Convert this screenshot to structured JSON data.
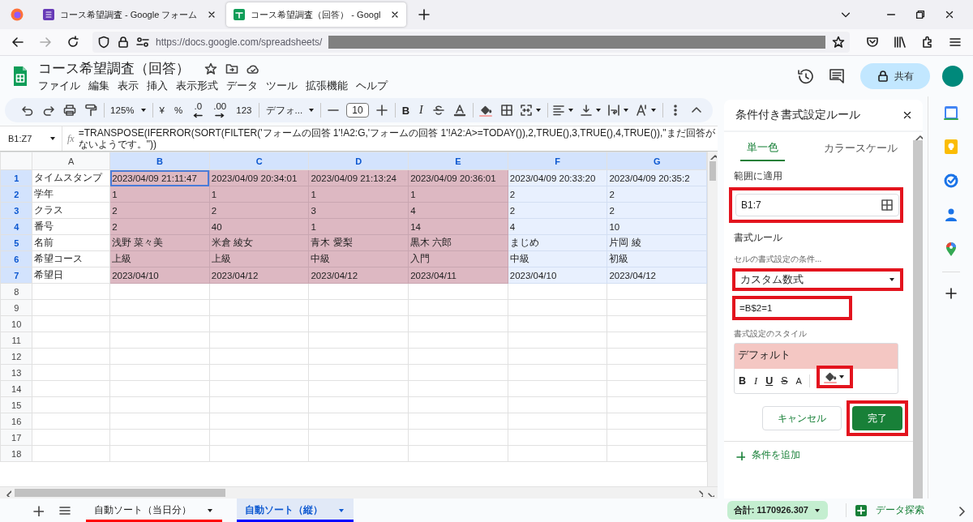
{
  "browser": {
    "tabs": [
      {
        "title": "コース希望調査 - Google フォーム",
        "selected": false,
        "kind": "forms"
      },
      {
        "title": "コース希望調査（回答） - Googl",
        "selected": true,
        "kind": "sheets"
      }
    ],
    "url": "https://docs.google.com/spreadsheets/"
  },
  "doc": {
    "title": "コース希望調査（回答）",
    "menu": [
      "ファイル",
      "編集",
      "表示",
      "挿入",
      "表示形式",
      "データ",
      "ツール",
      "拡張機能",
      "ヘルプ"
    ],
    "share": "共有"
  },
  "toolbar": [
    {
      "kind": "undo"
    },
    {
      "kind": "redo"
    },
    {
      "kind": "print"
    },
    {
      "kind": "paint"
    },
    {
      "kind": "sep"
    },
    {
      "kind": "dropdown",
      "text": "125%"
    },
    {
      "kind": "sep"
    },
    {
      "kind": "text",
      "text": "¥"
    },
    {
      "kind": "text",
      "text": "%"
    },
    {
      "kind": "decdown",
      "text": ".0"
    },
    {
      "kind": "decup",
      "text": ".00"
    },
    {
      "kind": "text",
      "text": "123"
    },
    {
      "kind": "sep"
    },
    {
      "kind": "dropdown",
      "text": "デフォ..."
    },
    {
      "kind": "sep"
    },
    {
      "kind": "minus"
    },
    {
      "kind": "size",
      "text": "10"
    },
    {
      "kind": "plus"
    },
    {
      "kind": "sep"
    },
    {
      "kind": "bold",
      "text": "B"
    },
    {
      "kind": "italic",
      "text": "I"
    },
    {
      "kind": "strike"
    },
    {
      "kind": "textcolor"
    },
    {
      "kind": "sep"
    },
    {
      "kind": "fill"
    },
    {
      "kind": "borders"
    },
    {
      "kind": "merge"
    },
    {
      "kind": "sep"
    },
    {
      "kind": "halign"
    },
    {
      "kind": "valign"
    },
    {
      "kind": "wrap"
    },
    {
      "kind": "rotate"
    },
    {
      "kind": "sep"
    },
    {
      "kind": "more"
    },
    {
      "kind": "collapse"
    }
  ],
  "formula_bar": {
    "cell_ref": "B1:Z7",
    "fx": "fx",
    "formula": "=TRANSPOSE(IFERROR(SORT(FILTER('フォームの回答 1'!A2:G,'フォームの回答 1'!A2:A>=TODAY()),2,TRUE(),3,TRUE(),4,TRUE()),\"まだ回答がないようです。\"))"
  },
  "grid": {
    "columns": [
      {
        "label": "A",
        "selected": false,
        "highlighted": false
      },
      {
        "label": "B",
        "selected": true,
        "highlighted": true
      },
      {
        "label": "C",
        "selected": true,
        "highlighted": true
      },
      {
        "label": "D",
        "selected": true,
        "highlighted": true
      },
      {
        "label": "E",
        "selected": true,
        "highlighted": true
      },
      {
        "label": "F",
        "selected": true,
        "highlighted": false
      },
      {
        "label": "G",
        "selected": true,
        "highlighted": false
      }
    ],
    "rows": [
      {
        "number": "1",
        "selected": true,
        "cells": [
          "タイムスタンプ",
          "2023/04/09 21:11:47",
          "2023/04/09 20:34:01",
          "2023/04/09 21:13:24",
          "2023/04/09 20:36:01",
          "2023/04/09 20:33:20",
          "2023/04/09 20:35:2"
        ]
      },
      {
        "number": "2",
        "selected": true,
        "cells": [
          "学年",
          "1",
          "1",
          "1",
          "1",
          "2",
          "2"
        ]
      },
      {
        "number": "3",
        "selected": true,
        "cells": [
          "クラス",
          "2",
          "2",
          "3",
          "4",
          "2",
          "2"
        ]
      },
      {
        "number": "4",
        "selected": true,
        "cells": [
          "番号",
          "2",
          "40",
          "1",
          "14",
          "4",
          "10"
        ]
      },
      {
        "number": "5",
        "selected": true,
        "cells": [
          "名前",
          "浅野 菜々美",
          "米倉 綾女",
          "青木 愛梨",
          "黒木 六郎",
          "まじめ",
          "片岡 綾"
        ]
      },
      {
        "number": "6",
        "selected": true,
        "cells": [
          "希望コース",
          "上級",
          "上級",
          "中級",
          "入門",
          "中級",
          "初級"
        ]
      },
      {
        "number": "7",
        "selected": true,
        "cells": [
          "希望日",
          "2023/04/10",
          "2023/04/12",
          "2023/04/12",
          "2023/04/11",
          "2023/04/10",
          "2023/04/12"
        ]
      },
      {
        "number": "8",
        "selected": false
      },
      {
        "number": "9",
        "selected": false
      },
      {
        "number": "10",
        "selected": false
      },
      {
        "number": "11",
        "selected": false
      },
      {
        "number": "12",
        "selected": false
      },
      {
        "number": "13",
        "selected": false
      },
      {
        "number": "14",
        "selected": false
      },
      {
        "number": "15",
        "selected": false
      },
      {
        "number": "16",
        "selected": false
      },
      {
        "number": "17",
        "selected": false
      },
      {
        "number": "18",
        "selected": false
      }
    ]
  },
  "panel": {
    "title": "条件付き書式設定ルール",
    "tabs": [
      {
        "label": "単一色",
        "selected": true
      },
      {
        "label": "カラースケール",
        "selected": false
      }
    ],
    "range_label": "範囲に適用",
    "range": {
      "value": "B1:7",
      "marked": true
    },
    "rules_label": "書式ルール",
    "condition_label": "セルの書式設定の条件...",
    "condition": {
      "value": "カスタム数式",
      "marked": true
    },
    "formula": {
      "value": "=B$2=1",
      "marked": true
    },
    "style_label": "書式設定のスタイル",
    "style_preview": "デフォルト",
    "style_tools": [
      {
        "kind": "bold",
        "text": "B",
        "marked": false
      },
      {
        "kind": "italic",
        "text": "I",
        "marked": false
      },
      {
        "kind": "underline",
        "text": "U",
        "marked": false
      },
      {
        "kind": "strike",
        "text": "S",
        "marked": false
      },
      {
        "kind": "color",
        "text": "A",
        "marked": false
      },
      {
        "kind": "fill",
        "marked": true
      }
    ],
    "buttons": [
      {
        "label": "キャンセル",
        "kind": "secondary",
        "marked": false
      },
      {
        "label": "完了",
        "kind": "primary",
        "marked": true
      }
    ],
    "add_rule": "条件を追加"
  },
  "sheet_bar": {
    "tabs": [
      {
        "label": "自動ソート（当日分）",
        "selected": false,
        "color": "#ff0000"
      },
      {
        "label": "自動ソート（縦）",
        "selected": true,
        "color": "#0000ff"
      }
    ],
    "sum": "合計: 1170926.307",
    "explore": "データ探索"
  }
}
